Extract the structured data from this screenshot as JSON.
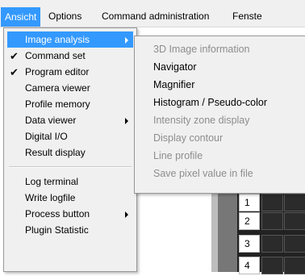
{
  "menubar": {
    "items": [
      "Ansicht",
      "Options",
      "Command administration",
      "Fenste"
    ]
  },
  "dropdown": {
    "items": [
      {
        "label": "Image analysis",
        "checked": false,
        "submenu": true,
        "highlighted": true
      },
      {
        "label": "Command set",
        "checked": true,
        "submenu": false
      },
      {
        "label": "Program editor",
        "checked": true,
        "submenu": false
      },
      {
        "label": "Camera viewer",
        "checked": false,
        "submenu": false
      },
      {
        "label": "Profile memory",
        "checked": false,
        "submenu": false
      },
      {
        "label": "Data viewer",
        "checked": false,
        "submenu": true
      },
      {
        "label": "Digital I/O",
        "checked": false,
        "submenu": false
      },
      {
        "label": "Result display",
        "checked": false,
        "submenu": false
      },
      {
        "label": "Log terminal",
        "checked": false,
        "submenu": false
      },
      {
        "label": "Write logfile",
        "checked": false,
        "submenu": false
      },
      {
        "label": "Process button",
        "checked": false,
        "submenu": true
      },
      {
        "label": "Plugin Statistic",
        "checked": false,
        "submenu": false
      }
    ],
    "check_glyph": "✔"
  },
  "submenu": {
    "items": [
      {
        "label": "3D Image information",
        "enabled": false
      },
      {
        "label": "Navigator",
        "enabled": true
      },
      {
        "label": "Magnifier",
        "enabled": true
      },
      {
        "label": "Histogram / Pseudo-color",
        "enabled": true
      },
      {
        "label": "Intensity zone display",
        "enabled": false
      },
      {
        "label": "Display contour",
        "enabled": false
      },
      {
        "label": "Line profile",
        "enabled": false
      },
      {
        "label": "Save pixel value in file",
        "enabled": false
      }
    ]
  },
  "grid": {
    "row_numbers": [
      "1",
      "2",
      "3",
      "4"
    ]
  },
  "colors": {
    "highlight": "#3399ff",
    "menu_bg": "#f0f0f0",
    "disabled_text": "#8d8d8d"
  }
}
